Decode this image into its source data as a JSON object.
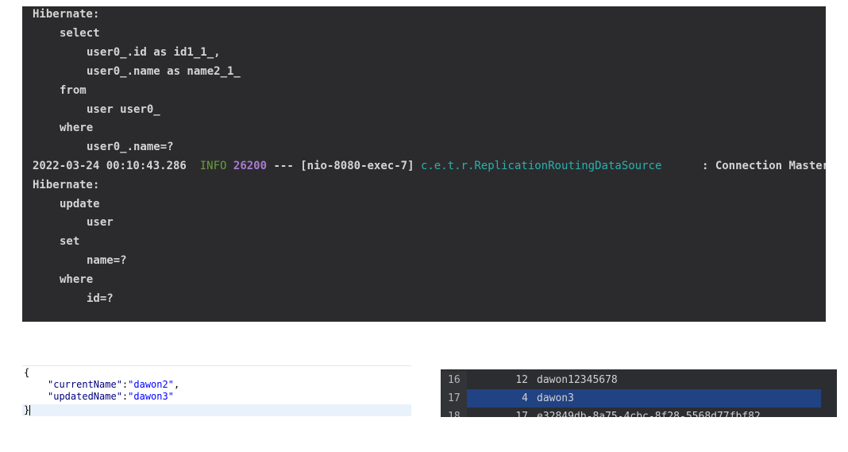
{
  "console": {
    "lines": [
      "Hibernate:",
      "select",
      "user0_.id as id1_1_,",
      "user0_.name as name2_1_",
      "from",
      "user user0_",
      "where",
      "user0_.name=?",
      "",
      "Hibernate:",
      "update",
      "user",
      "set",
      "name=?",
      "where",
      "id=?"
    ],
    "log": {
      "timestamp": "2022-03-24 00:10:43.286",
      "level": "INFO",
      "pid": "26200",
      "separator": "---",
      "thread": "[nio-8080-exec-7]",
      "logger": "c.e.t.r.ReplicationRoutingDataSource",
      "message": ": Connection Master"
    }
  },
  "json_editor": {
    "open_brace": "{",
    "close_brace": "}",
    "fields": [
      {
        "key": "\"currentName\"",
        "colon": ":",
        "value": "\"dawon2\"",
        "comma": ","
      },
      {
        "key": "\"updatedName\"",
        "colon": ":",
        "value": "\"dawon3\"",
        "comma": ""
      }
    ]
  },
  "db_grid": {
    "rows": [
      {
        "row": "16",
        "id": "12",
        "name": "dawon12345678",
        "selected": false
      },
      {
        "row": "17",
        "id": "4",
        "name": "dawon3",
        "selected": true
      },
      {
        "row": "18",
        "id": "17",
        "name": "e32849db-8a75-4cbc-8f28-5568d77fbf82",
        "selected": false
      }
    ]
  },
  "colors": {
    "console_bg": "#2b2b2d",
    "log_level": "#6a9e3b",
    "pid": "#a97bd0",
    "logger": "#2ab0ad",
    "selection": "#214283"
  }
}
